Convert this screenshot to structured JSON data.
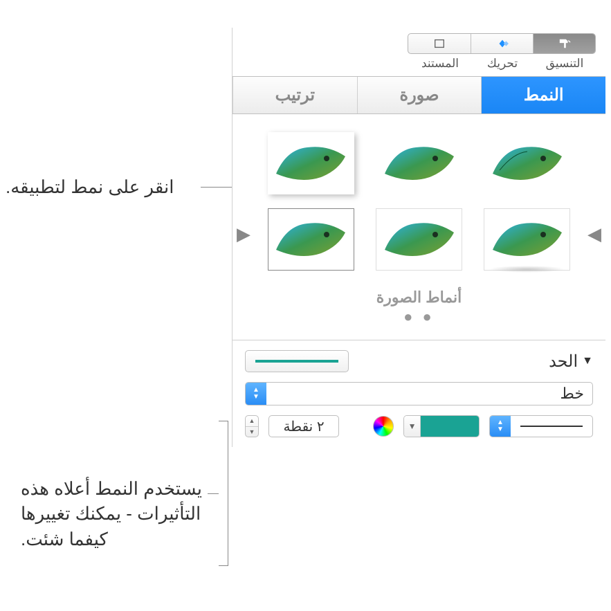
{
  "toolbar": {
    "items": [
      {
        "label": "التنسيق",
        "icon": "format-brush"
      },
      {
        "label": "تحريك",
        "icon": "animate-diamond"
      },
      {
        "label": "المستند",
        "icon": "document-rect"
      }
    ]
  },
  "tabs": {
    "style": "النمط",
    "image": "صورة",
    "arrange": "ترتيب"
  },
  "styles": {
    "section_label": "أنماط الصورة"
  },
  "border": {
    "title": "الحد",
    "type": "خط",
    "size": "٢ نقطة",
    "color": "#1aa394"
  },
  "callouts": {
    "apply": "انقر على نمط لتطبيقه.",
    "effects": "يستخدم النمط أعلاه هذه التأثيرات - يمكنك تغييرها كيفما شئت."
  }
}
